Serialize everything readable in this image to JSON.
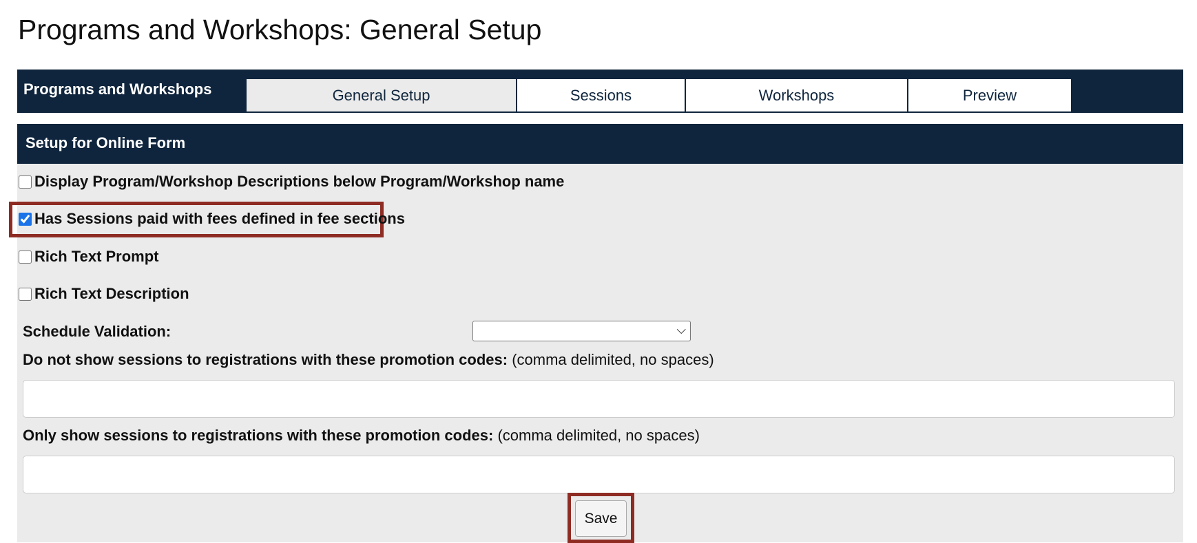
{
  "page": {
    "title": "Programs and Workshops: General Setup"
  },
  "tabs_bar": {
    "section_label": "Programs and Workshops",
    "tabs": [
      {
        "label": "General Setup",
        "active": true
      },
      {
        "label": "Sessions",
        "active": false
      },
      {
        "label": "Workshops",
        "active": false
      },
      {
        "label": "Preview",
        "active": false
      }
    ]
  },
  "form": {
    "header": "Setup for Online Form",
    "checkboxes": [
      {
        "label": "Display Program/Workshop Descriptions below Program/Workshop name",
        "checked": false
      },
      {
        "label": "Has Sessions paid with fees defined in fee sections",
        "checked": true
      },
      {
        "label": "Rich Text Prompt",
        "checked": false
      },
      {
        "label": "Rich Text Description",
        "checked": false
      }
    ],
    "schedule_validation": {
      "label": "Schedule Validation:",
      "value": ""
    },
    "exclude_codes": {
      "label": "Do not show sessions to registrations with these promotion codes:",
      "hint": "(comma delimited, no spaces)",
      "value": ""
    },
    "include_codes": {
      "label": "Only show sessions to registrations with these promotion codes:",
      "hint": "(comma delimited, no spaces)",
      "value": ""
    },
    "save_label": "Save"
  },
  "colors": {
    "navy": "#0f253d",
    "panel": "#ebebeb",
    "highlight": "#8e2c24"
  }
}
